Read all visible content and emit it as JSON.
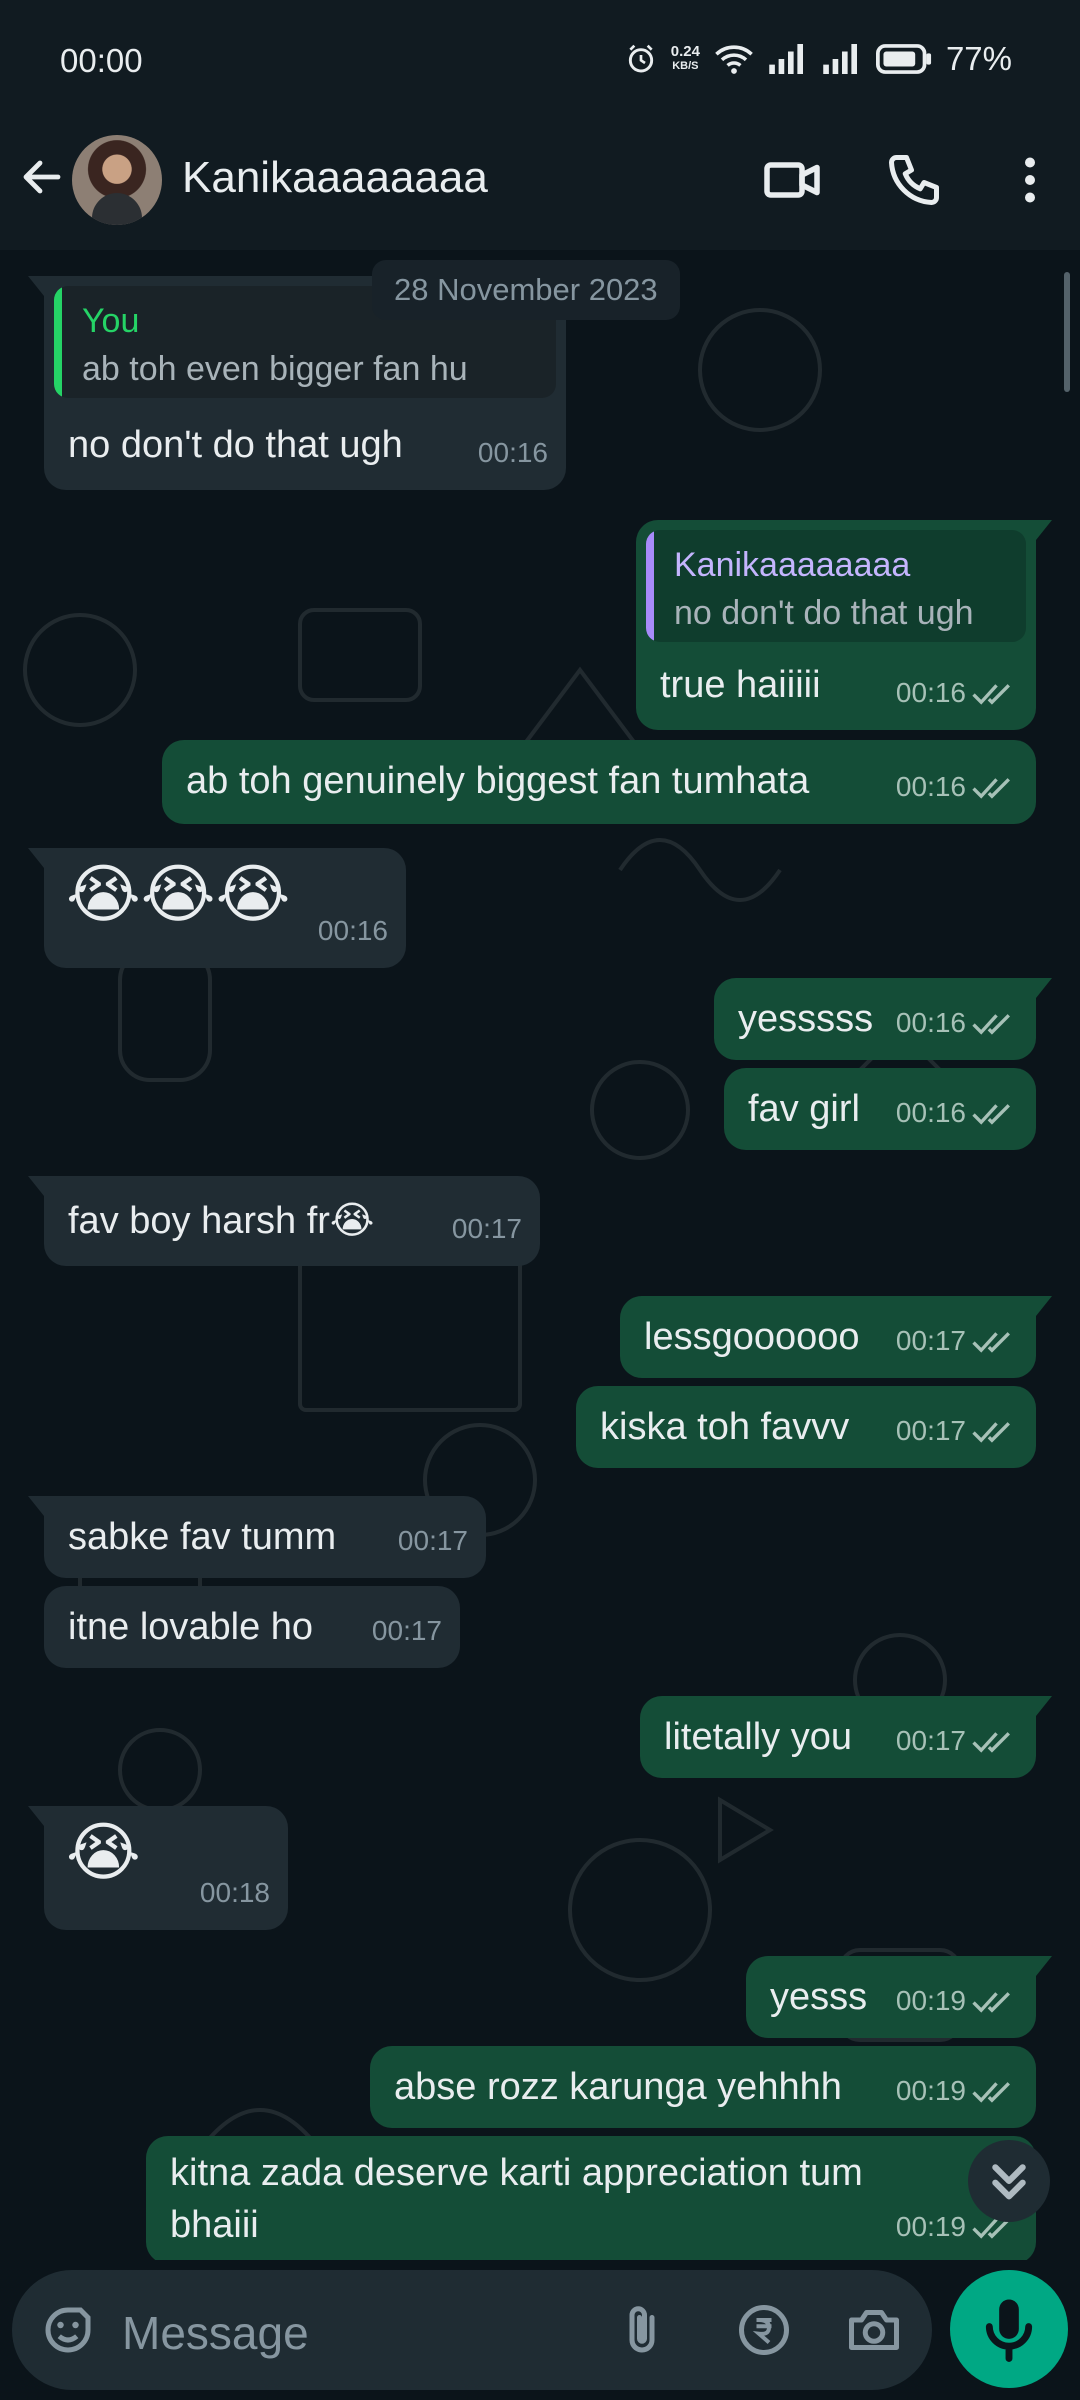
{
  "status": {
    "time": "00:00",
    "net_speed": "0.24",
    "net_unit": "KB/S",
    "battery": "77%"
  },
  "header": {
    "contact_name": "Kanikaaaaaaaa"
  },
  "chat": {
    "date": "28 November 2023",
    "messages": [
      {
        "dir": "in",
        "quote_name": "You",
        "quote_text": "ab toh even bigger fan hu",
        "text": "no don't do that ugh",
        "time": "00:16"
      },
      {
        "dir": "out",
        "quote_name": "Kanikaaaaaaaa",
        "quote_text": "no don't do that ugh",
        "text": "true haiiiii",
        "time": "00:16"
      },
      {
        "dir": "out",
        "text": "ab toh genuinely biggest fan tumhata",
        "time": "00:16"
      },
      {
        "dir": "in",
        "text": "😭😭😭",
        "time": "00:16"
      },
      {
        "dir": "out",
        "text": "yesssss",
        "time": "00:16"
      },
      {
        "dir": "out",
        "text": "fav girl",
        "time": "00:16"
      },
      {
        "dir": "in",
        "text": "fav boy harsh fr😭",
        "time": "00:17"
      },
      {
        "dir": "out",
        "text": "lessgoooooo",
        "time": "00:17"
      },
      {
        "dir": "out",
        "text": "kiska toh favvv",
        "time": "00:17"
      },
      {
        "dir": "in",
        "text": "sabke fav tumm",
        "time": "00:17"
      },
      {
        "dir": "in",
        "text": "itne lovable ho",
        "time": "00:17"
      },
      {
        "dir": "out",
        "text": "litetally you",
        "time": "00:17"
      },
      {
        "dir": "in",
        "text": "😭",
        "time": "00:18"
      },
      {
        "dir": "out",
        "text": "yesss",
        "time": "00:19"
      },
      {
        "dir": "out",
        "text": "abse rozz karunga yehhhh",
        "time": "00:19"
      },
      {
        "dir": "out",
        "text_line1": "kitna zada deserve karti appreciation tum",
        "text_line2": "bhaiii",
        "time": "00:19"
      }
    ]
  },
  "input": {
    "placeholder": "Message"
  },
  "colors": {
    "outgoing_bubble": "#144d37",
    "incoming_bubble": "#202c33",
    "accent": "#00a884",
    "quote_you": "#25d366",
    "quote_contact": "#a78bfa"
  }
}
